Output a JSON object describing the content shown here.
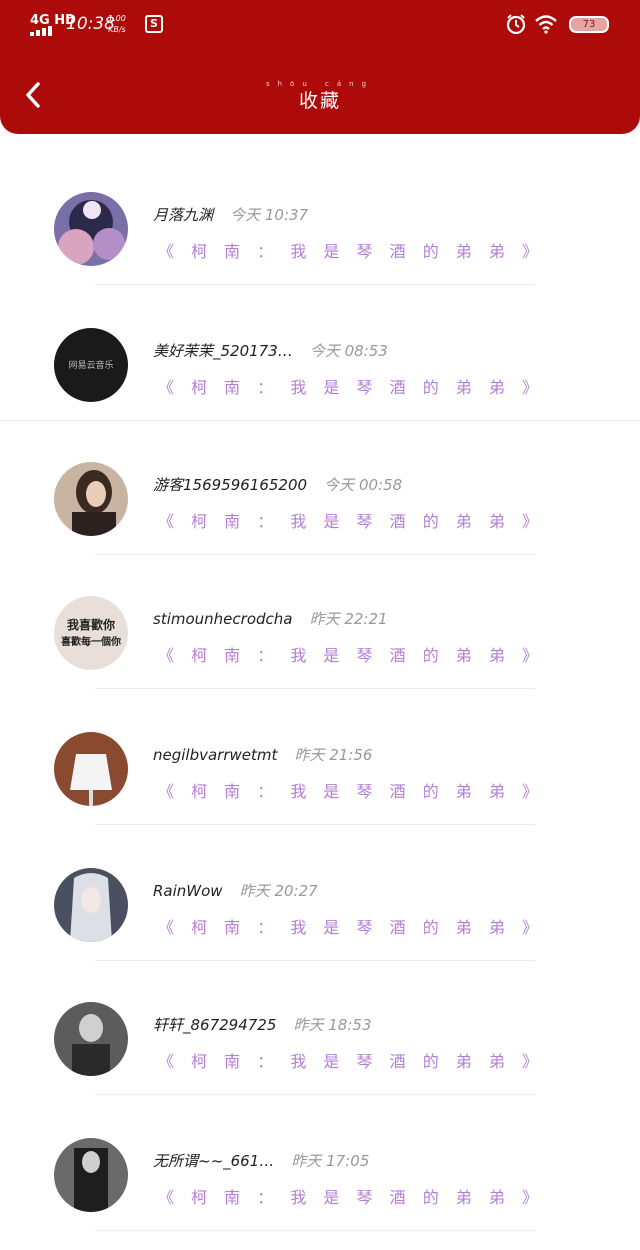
{
  "status_bar": {
    "network": "4G HD",
    "time": "10:38",
    "speed_top": "1.00",
    "speed_bottom": "KB/s",
    "app_icon": "S",
    "battery": "73"
  },
  "header": {
    "title": "收藏",
    "title_pinyin": "shōu cáng",
    "back_icon": "chevron-left-icon"
  },
  "colors": {
    "header_bg": "#ad0a0a",
    "title_link": "#b67fd6"
  },
  "items": [
    {
      "name": "月落九渊",
      "time": "今天 10:37",
      "title": "《 柯 南 ： 我 是 琴 酒 的 弟 弟 》"
    },
    {
      "name": "美好茉茉_520173…",
      "time": "今天 08:53",
      "title": "《 柯 南 ： 我 是 琴 酒 的 弟 弟 》"
    },
    {
      "name": "游客1569596165200",
      "time": "今天 00:58",
      "title": "《 柯 南 ： 我 是 琴 酒 的 弟 弟 》"
    },
    {
      "name": "stimounhecrodcha",
      "time": "昨天 22:21",
      "title": "《 柯 南 ： 我 是 琴 酒 的 弟 弟 》"
    },
    {
      "name": "negilbvarrwetmt",
      "time": "昨天 21:56",
      "title": "《 柯 南 ： 我 是 琴 酒 的 弟 弟 》"
    },
    {
      "name": "RainWow",
      "time": "昨天 20:27",
      "title": "《 柯 南 ： 我 是 琴 酒 的 弟 弟 》"
    },
    {
      "name": "轩轩_867294725",
      "time": "昨天 18:53",
      "title": "《 柯 南 ： 我 是 琴 酒 的 弟 弟 》"
    },
    {
      "name": "无所谓~~_661…",
      "time": "昨天 17:05",
      "title": "《 柯 南 ： 我 是 琴 酒 的 弟 弟 》"
    }
  ],
  "avatar_texts": {
    "item2": "网易云音乐",
    "item4_line1": "我喜歡你",
    "item4_line2": "喜歡每一個你"
  }
}
